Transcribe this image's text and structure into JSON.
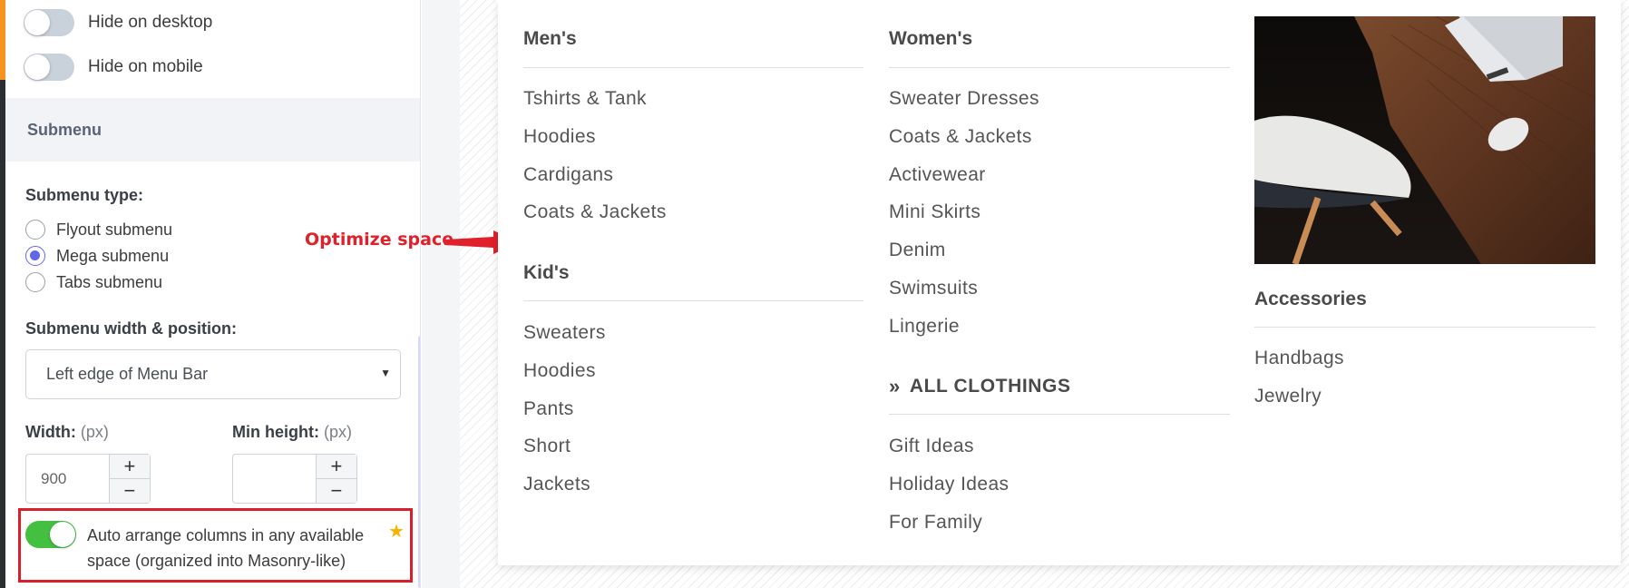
{
  "sidebar": {
    "hide_desktop_label": "Hide on desktop",
    "hide_mobile_label": "Hide on mobile",
    "section_title": "Submenu",
    "submenu_type_label": "Submenu type:",
    "submenu_types": [
      "Flyout submenu",
      "Mega submenu",
      "Tabs submenu"
    ],
    "submenu_type_selected": "Mega submenu",
    "width_position_label": "Submenu width & position:",
    "width_position_value": "Left edge of Menu Bar",
    "width_label": "Width:",
    "width_unit": "(px)",
    "width_value": "900",
    "min_height_label": "Min height:",
    "min_height_unit": "(px)",
    "min_height_value": "",
    "plus": "+",
    "minus": "−",
    "auto_arrange_label": "Auto arrange columns in any available space (organized into Masonry-like)",
    "auto_arrange_on": true,
    "hide_desktop_on": false,
    "hide_mobile_on": false,
    "accent_color": "#6366e8",
    "toggle_on_color": "#44c040",
    "highlight_color": "#d9202a"
  },
  "annotation": {
    "text": "Optimize space",
    "color": "#e0202a"
  },
  "megamenu": {
    "mens": {
      "heading": "Men's",
      "items": [
        "Tshirts & Tank",
        "Hoodies",
        "Cardigans",
        "Coats & Jackets"
      ]
    },
    "kids": {
      "heading": "Kid's",
      "items": [
        "Sweaters",
        "Hoodies",
        "Pants",
        "Short",
        "Jackets"
      ]
    },
    "womens": {
      "heading": "Women's",
      "items": [
        "Sweater Dresses",
        "Coats & Jackets",
        "Activewear",
        "Mini Skirts",
        "Denim",
        "Swimsuits",
        "Lingerie"
      ]
    },
    "all_clothings": {
      "heading": "ALL CLOTHINGS",
      "icon": "double-chevron-right-icon",
      "items": [
        "Gift Ideas",
        "Holiday Ideas",
        "For Family"
      ]
    },
    "accessories": {
      "heading": "Accessories",
      "items": [
        "Handbags",
        "Jewelry"
      ]
    }
  }
}
